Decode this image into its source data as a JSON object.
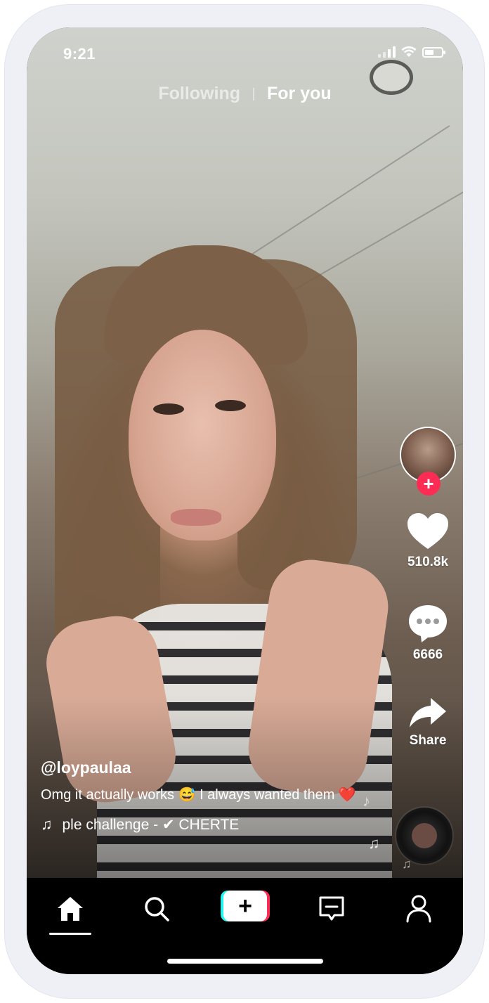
{
  "status_bar": {
    "time": "9:21"
  },
  "top_tabs": [
    {
      "label": "Following",
      "active": false
    },
    {
      "label": "For you",
      "active": true
    }
  ],
  "post": {
    "username": "@loypaulaa",
    "caption": "Omg it actually works 😅 I always wanted them ❤️",
    "music": "ple challenge - ✔ CHERTE"
  },
  "actions": {
    "likes": "510.8k",
    "comments": "6666",
    "share": "Share"
  },
  "bottom_nav": [
    "home-icon",
    "search-icon",
    "create-icon",
    "inbox-icon",
    "profile-icon"
  ],
  "colors": {
    "accent_red": "#fe2c55",
    "accent_cyan": "#25f4ee"
  }
}
